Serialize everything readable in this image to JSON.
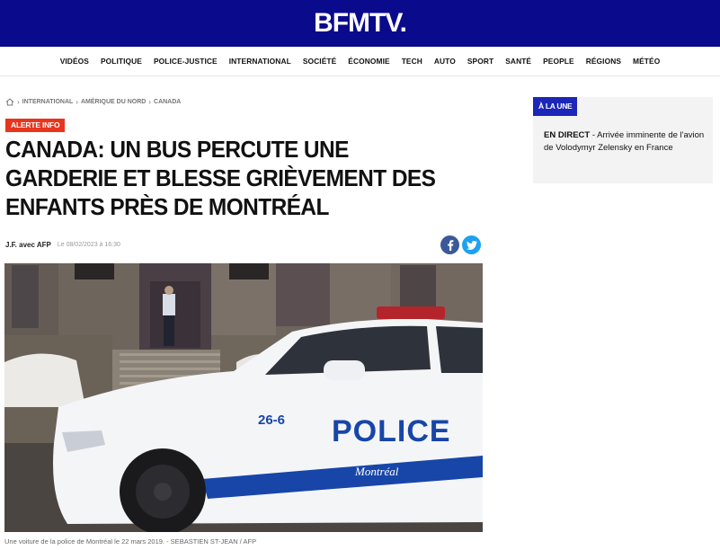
{
  "header": {
    "logo_text": "BFMTV.",
    "brand_color": "#0a0a8c"
  },
  "nav": {
    "items": [
      {
        "label": "VIDÉOS"
      },
      {
        "label": "POLITIQUE"
      },
      {
        "label": "POLICE-JUSTICE"
      },
      {
        "label": "INTERNATIONAL"
      },
      {
        "label": "SOCIÉTÉ"
      },
      {
        "label": "ÉCONOMIE"
      },
      {
        "label": "TECH"
      },
      {
        "label": "AUTO"
      },
      {
        "label": "SPORT"
      },
      {
        "label": "SANTÉ"
      },
      {
        "label": "PEOPLE"
      },
      {
        "label": "RÉGIONS"
      },
      {
        "label": "MÉTÉO"
      }
    ]
  },
  "breadcrumb": {
    "home_icon": "home-icon",
    "items": [
      {
        "label": "INTERNATIONAL"
      },
      {
        "label": "AMÉRIQUE DU NORD"
      },
      {
        "label": "CANADA"
      }
    ]
  },
  "article": {
    "alert_label": "ALERTE INFO",
    "alert_color": "#e8351e",
    "title": "CANADA: UN BUS PERCUTE UNE GARDERIE ET BLESSE GRIÈVEMENT DES ENFANTS PRÈS DE MONTRÉAL",
    "author": "J.F. avec AFP",
    "date": "Le 08/02/2023 à 16:30",
    "share": {
      "facebook_icon": "facebook-icon",
      "twitter_icon": "twitter-icon"
    },
    "image": {
      "car_number": "26-6",
      "car_text": "POLICE",
      "car_city": "Montréal"
    },
    "caption": "Une voiture de la police de Montréal le 22 mars 2019. - SEBASTIEN ST-JEAN / AFP"
  },
  "sidebar": {
    "badge": "À LA UNE",
    "badge_color": "#1c26b8",
    "headline_prefix": "EN DIRECT",
    "headline_text": " - Arrivée imminente de l'avion de Volodymyr Zelensky en France"
  }
}
